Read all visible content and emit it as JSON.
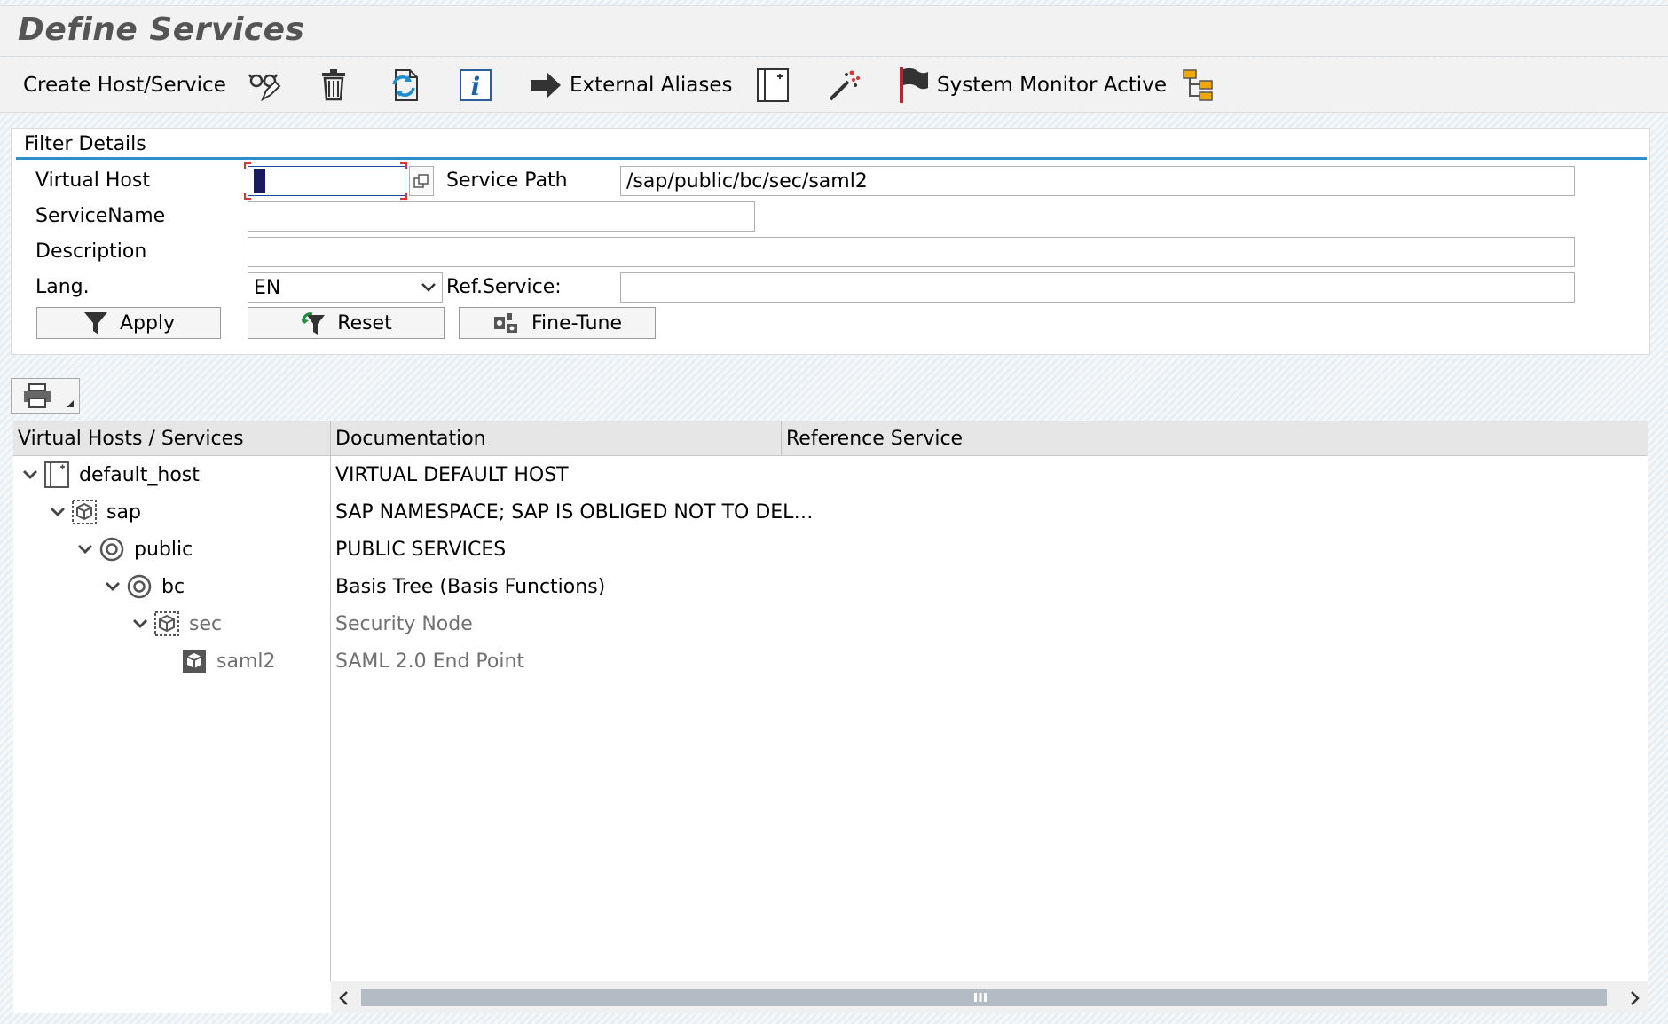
{
  "window": {
    "title": "Define Services"
  },
  "toolbar": {
    "create_label": "Create Host/Service",
    "external_aliases_label": "External Aliases",
    "system_monitor_label": "System Monitor Active",
    "icons": [
      "glasses-pencil-icon",
      "trash-icon",
      "refresh-icon",
      "info-icon",
      "arrow-right-icon",
      "host-page-icon",
      "magic-wand-icon",
      "red-flag-icon",
      "hierarchy-icon"
    ]
  },
  "filter": {
    "header": "Filter Details",
    "virtual_host_label": "Virtual Host",
    "virtual_host_value": "",
    "service_path_label": "Service Path",
    "service_path_value": "/sap/public/bc/sec/saml2",
    "service_name_label": "ServiceName",
    "service_name_value": "",
    "description_label": "Description",
    "description_value": "",
    "lang_label": "Lang.",
    "lang_value": "EN",
    "ref_service_label": "Ref.Service:",
    "ref_service_value": "",
    "apply_label": "Apply",
    "reset_label": "Reset",
    "finetune_label": "Fine-Tune"
  },
  "tree": {
    "columns": [
      "Virtual Hosts / Services",
      "Documentation",
      "Reference Service"
    ],
    "rows": [
      {
        "name": "default_host",
        "doc": "VIRTUAL DEFAULT HOST",
        "ref": "",
        "level": 0,
        "icon": "host-page-icon",
        "expanded": true,
        "dim": false
      },
      {
        "name": "sap",
        "doc": "SAP NAMESPACE; SAP IS OBLIGED NOT TO DEL…",
        "ref": "",
        "level": 1,
        "icon": "package-icon",
        "expanded": true,
        "dim": false
      },
      {
        "name": "public",
        "doc": "PUBLIC SERVICES",
        "ref": "",
        "level": 2,
        "icon": "target-icon",
        "expanded": true,
        "dim": false
      },
      {
        "name": "bc",
        "doc": "Basis Tree (Basis Functions)",
        "ref": "",
        "level": 3,
        "icon": "target-icon",
        "expanded": true,
        "dim": false
      },
      {
        "name": "sec",
        "doc": "Security Node",
        "ref": "",
        "level": 4,
        "icon": "package-icon",
        "expanded": true,
        "dim": true
      },
      {
        "name": "saml2",
        "doc": "SAML 2.0 End Point",
        "ref": "",
        "level": 5,
        "icon": "cube-icon",
        "expanded": false,
        "dim": true
      }
    ]
  },
  "colors": {
    "accent_line": "#2c8fc9",
    "flag": "#c0202b",
    "hierarchy": "#f0a800"
  }
}
